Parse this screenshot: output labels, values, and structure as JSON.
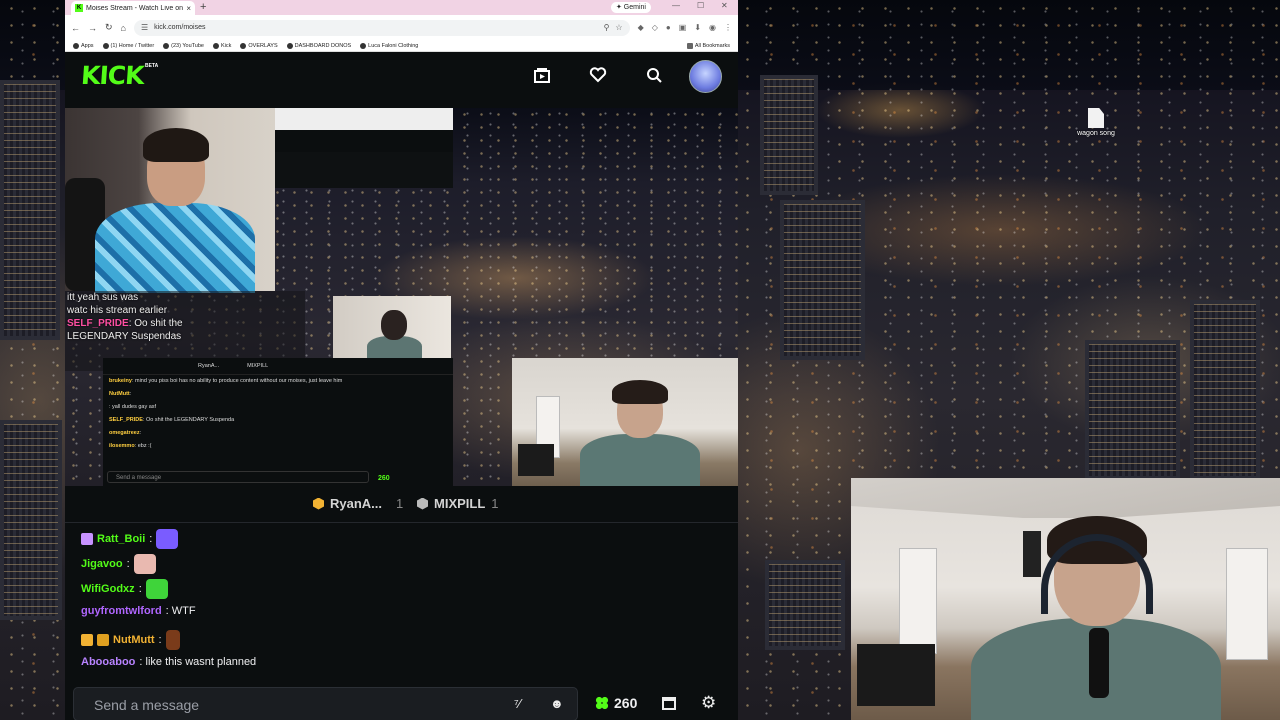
{
  "browser": {
    "tab_title": "Moises Stream - Watch Live on",
    "tab_favicon": "K",
    "new_tab": "+",
    "gemini_label": "✦ Gemini",
    "url": "kick.com/moises",
    "bookmarks": [
      {
        "label": "Apps"
      },
      {
        "label": "(1) Home / Twitter"
      },
      {
        "label": "(23) YouTube"
      },
      {
        "label": "Kick"
      },
      {
        "label": "OVERLAYS"
      },
      {
        "label": "DASHBOARD DONOS"
      },
      {
        "label": "Luca Faloni Clothing"
      }
    ],
    "all_bookmarks": "All Bookmarks"
  },
  "kick": {
    "logo": "KICK",
    "beta": "BETA",
    "brand_color": "#53fc18"
  },
  "player": {
    "overlay_chat": [
      {
        "user": "",
        "text": "itt yeah sus was"
      },
      {
        "user": "",
        "text": "watc  his stream earlier"
      },
      {
        "user": "SELF_PRIDE",
        "text": ": Oo shit the"
      },
      {
        "user": "",
        "text": "LEGENDARY Suspendas"
      }
    ],
    "nested_chat": {
      "tab1": "RyanA...",
      "tab2": "MIXPILL",
      "lines": [
        {
          "user": "brukeiny",
          "text": ": mind you piss boi has no ability to produce content without our moises, just leave him"
        },
        {
          "user": "NutMutt",
          "text": ":"
        },
        {
          "user": "",
          "text": ": yall dudes gay asf"
        },
        {
          "user": "SELF_PRIDE",
          "text": ": Oo shit the LEGENDARY Suspenda"
        },
        {
          "user": "omegatreez",
          "text": ":"
        },
        {
          "user": "ilosemmo",
          "text": ": ebz :("
        }
      ],
      "placeholder": "Send a message",
      "points": "260"
    }
  },
  "chat": {
    "tabs": [
      {
        "name": "RyanA...",
        "count": "1",
        "color": "#f2b233"
      },
      {
        "name": "MIXPILL",
        "count": "1",
        "color": "#bbbbbb"
      }
    ],
    "messages": [
      {
        "user": "Ratt_Boii",
        "text": ":",
        "color": "#53fc18",
        "badge": "#c792ff",
        "emote": "#7a5cff"
      },
      {
        "user": "Jigavoo",
        "text": ":",
        "color": "#53fc18",
        "badge": "",
        "emote": "#e9b9b0"
      },
      {
        "user": "WifiGodxz",
        "text": ":",
        "color": "#53fc18",
        "badge": "",
        "emote": "#3fd43a"
      },
      {
        "user": "guyfromtwlford",
        "text": ": WTF",
        "color": "#b066ff",
        "badge": "",
        "emote": ""
      },
      {
        "user": "NutMutt",
        "text": ":",
        "color": "#f2b233",
        "badge": "#f2b233",
        "emote": "#7a3b1a"
      },
      {
        "user": "Abooaboo",
        "text": ": like this wasnt planned",
        "color": "#b883ff",
        "badge": "",
        "emote": ""
      }
    ],
    "input_placeholder": "Send a message",
    "points": "260"
  },
  "desktop": {
    "icon_label": "wagon song"
  }
}
